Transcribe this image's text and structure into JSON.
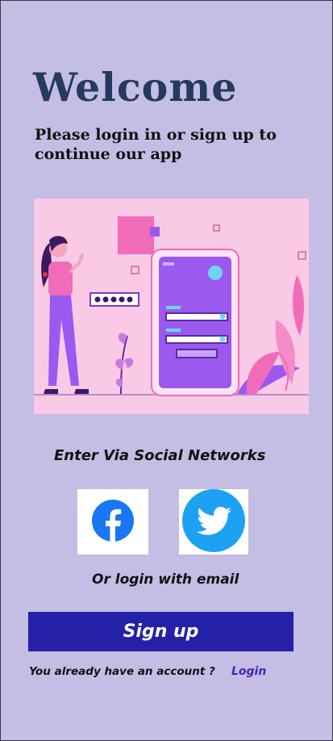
{
  "header": {
    "title": "Welcome",
    "subtitle": "Please login in or sign up to continue our app"
  },
  "illustration": {
    "icon": "onboarding-illustration",
    "colors": {
      "background": "#f9c9e6",
      "accent": "#9b59f0",
      "figure": "#7a3ec0"
    }
  },
  "social": {
    "heading": "Enter Via Social Networks",
    "facebook_icon": "facebook-icon",
    "twitter_icon": "twitter-icon"
  },
  "email": {
    "label": "Or login with email"
  },
  "actions": {
    "signup_label": "Sign up",
    "account_prompt": "You already have an account ?",
    "login_label": "Login"
  },
  "colors": {
    "page_background": "#c4bde4",
    "title": "#243a5e",
    "primary_button": "#2420a8",
    "link": "#4b1fb8",
    "facebook": "#1877f2",
    "twitter": "#1da1f2"
  }
}
